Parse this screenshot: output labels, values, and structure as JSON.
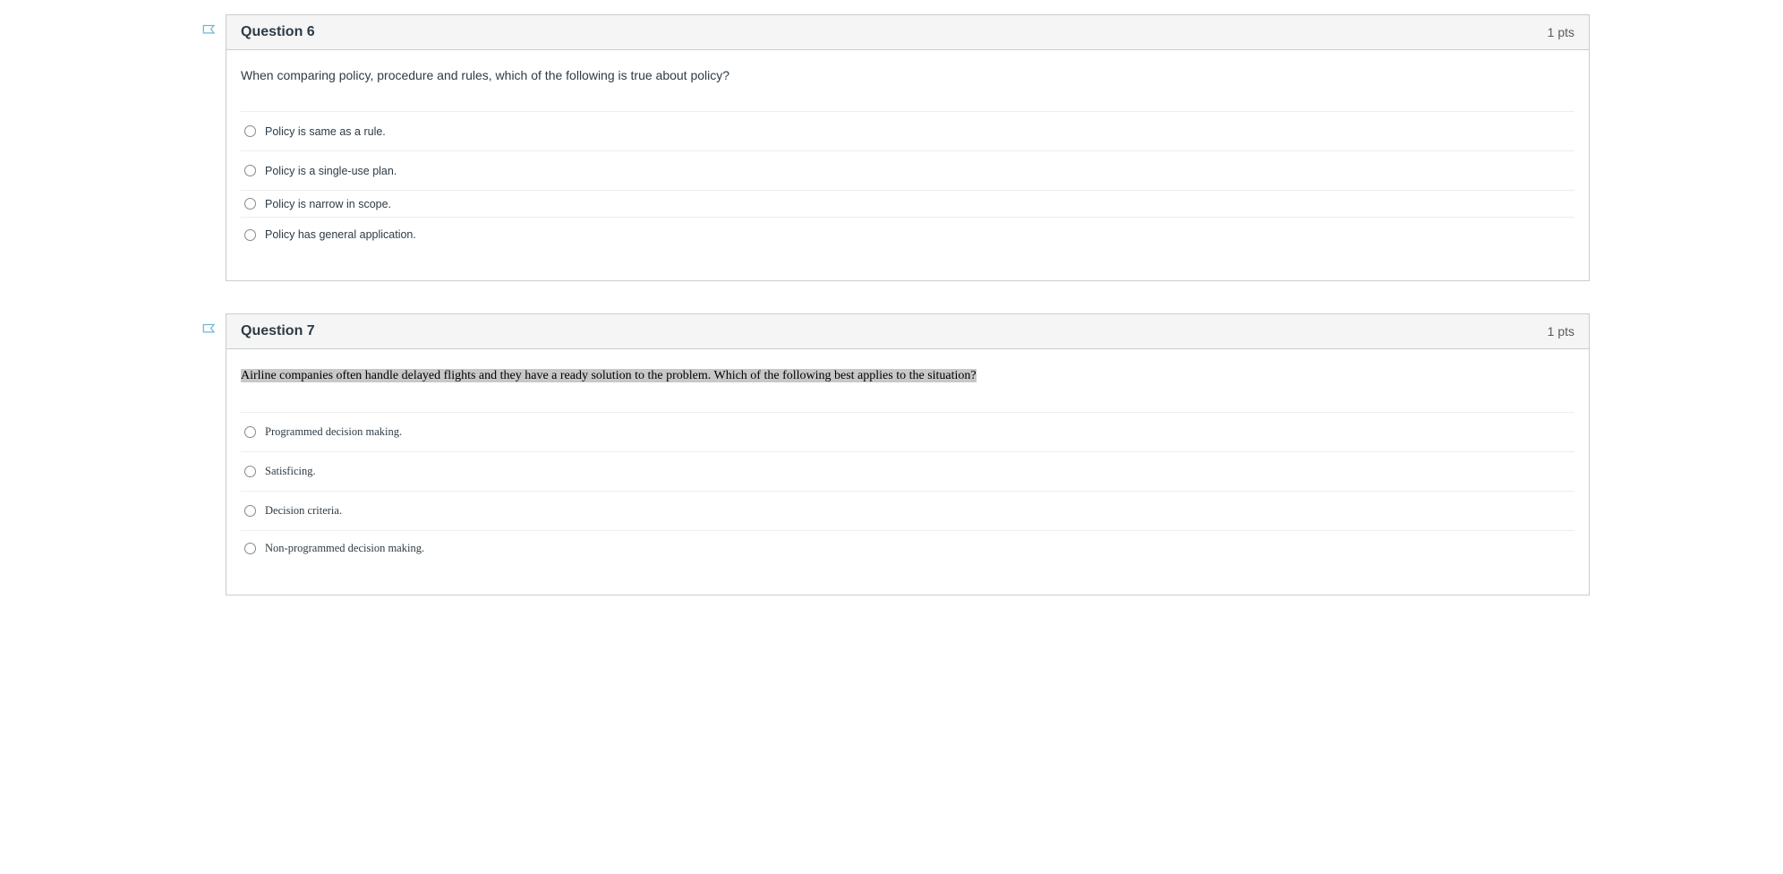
{
  "questions": [
    {
      "title": "Question 6",
      "points": "1 pts",
      "prompt": "When comparing policy, procedure and rules, which of the following is true about policy?",
      "prompt_highlighted": false,
      "serif_options": false,
      "options": [
        {
          "label": "Policy is same as a rule.",
          "compact": false
        },
        {
          "label": "Policy is a single-use plan.",
          "compact": false
        },
        {
          "label": "Policy is narrow in scope.",
          "compact": true
        },
        {
          "label": "Policy has general application.",
          "compact": false
        }
      ]
    },
    {
      "title": "Question 7",
      "points": "1 pts",
      "prompt": "Airline companies often handle delayed flights and they have a ready solution to the problem. Which of the following best applies to the situation?",
      "prompt_highlighted": true,
      "serif_options": true,
      "options": [
        {
          "label": "Programmed decision making.",
          "compact": false
        },
        {
          "label": "Satisficing.",
          "compact": false
        },
        {
          "label": "Decision criteria.",
          "compact": false
        },
        {
          "label": "Non-programmed decision making.",
          "compact": false
        }
      ]
    }
  ]
}
